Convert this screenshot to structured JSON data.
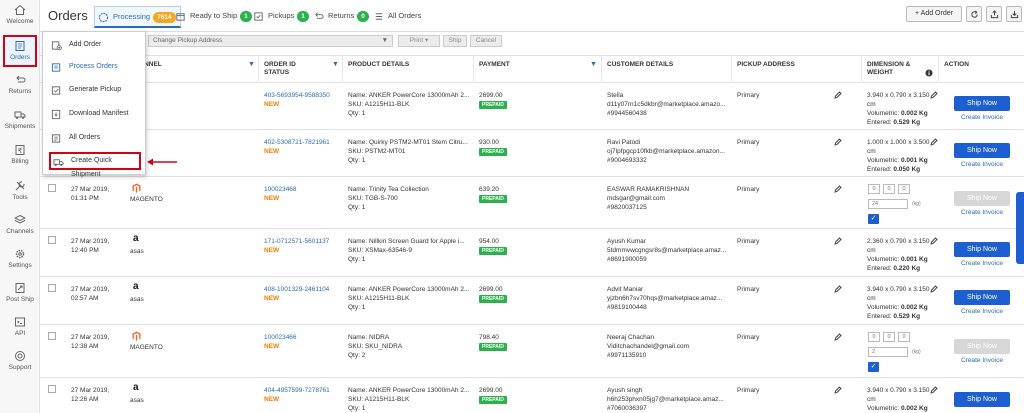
{
  "sidebar": {
    "items": [
      {
        "label": "Welcome",
        "icon": "home-icon"
      },
      {
        "label": "Orders",
        "icon": "orders-icon"
      },
      {
        "label": "Returns",
        "icon": "returns-icon"
      },
      {
        "label": "Shipments",
        "icon": "truck-icon"
      },
      {
        "label": "Billing",
        "icon": "billing-icon"
      },
      {
        "label": "Tools",
        "icon": "tools-icon"
      },
      {
        "label": "Channels",
        "icon": "channels-icon"
      },
      {
        "label": "Settings",
        "icon": "gear-icon"
      },
      {
        "label": "Post Ship",
        "icon": "post-ship-icon"
      },
      {
        "label": "API",
        "icon": "api-icon"
      },
      {
        "label": "Support",
        "icon": "support-icon"
      }
    ]
  },
  "header": {
    "title": "Orders",
    "tabs": [
      {
        "label": "Processing",
        "count": "7614",
        "badge_color": "#f5a623"
      },
      {
        "label": "Ready to Ship",
        "count": "1",
        "badge_color": "#2bb24c"
      },
      {
        "label": "Pickups",
        "count": "1",
        "badge_color": "#2bb24c"
      },
      {
        "label": "Returns",
        "count": "0",
        "badge_color": "#2bb24c"
      },
      {
        "label": "All Orders",
        "count": ""
      }
    ],
    "add_order_label": "+ Add Order"
  },
  "toolbar": {
    "pickup_placeholder": "Change Pickup Address",
    "print_label": "Print ▾",
    "ship_label": "Ship",
    "cancel_label": "Cancel"
  },
  "menu": {
    "items": [
      {
        "label": "Add Order"
      },
      {
        "label": "Process Orders"
      },
      {
        "label": "Generate Pickup"
      },
      {
        "label": "Download Manifest"
      },
      {
        "label": "All Orders"
      },
      {
        "label": "Create Quick Shipment"
      }
    ]
  },
  "table": {
    "headers": {
      "channel": "CHANNEL",
      "order_id": "ORDER ID",
      "status": "STATUS",
      "product": "PRODUCT DETAILS",
      "payment": "PAYMENT",
      "customer": "CUSTOMER DETAILS",
      "pickup": "PICKUP ADDRESS",
      "dimension": "DIMENSION &",
      "weight": "WEIGHT",
      "action": "ACTION"
    },
    "rows": [
      {
        "date": "",
        "time": "",
        "channel": "",
        "order_id": "403-5693954-9588350",
        "status": "NEW",
        "product_name": "Name: ANKER PowerCore 13000mAh 2...",
        "sku": "SKU: A1215H11-BLK",
        "qty": "Qty: 1",
        "amount": "2699.00",
        "payment_type": "PREPAID",
        "cust_name": "Stella",
        "cust_email": "d11y07rn1c5dkbr@marketplace.amazo...",
        "cust_phone": "#9944560438",
        "pickup": "Primary",
        "dims": "3.940 x 0.790 x 3.150",
        "unit": "cm",
        "volumetric_label": "Volumetric:",
        "volumetric": "0.002 Kg",
        "entered_label": "Entered:",
        "entered": "0.529 Kg",
        "ship_label": "Ship Now",
        "invoice_label": "Create Invoice",
        "ship_enabled": true
      },
      {
        "date": "",
        "time": "",
        "channel": "",
        "order_id": "402-5308721-7821961",
        "status": "NEW",
        "product_name": "Name: Quirky PSTM2-MT01 Stem Citru...",
        "sku": "SKU: PSTM2-MT01",
        "qty": "Qty: 1",
        "amount": "930.00",
        "payment_type": "PREPAID",
        "cust_name": "Ravi Patodi",
        "cust_email": "oj7lpfpgcp10fkb@marketplace.amazon...",
        "cust_phone": "#9004693332",
        "pickup": "Primary",
        "dims": "1.000 x 1.000 x 3.500",
        "unit": "cm",
        "volumetric_label": "Volumetric:",
        "volumetric": "0.001 Kg",
        "entered_label": "Entered:",
        "entered": "0.050 Kg",
        "ship_label": "Ship Now",
        "invoice_label": "Create Invoice",
        "ship_enabled": true
      },
      {
        "date": "27 Mar 2019,",
        "time": "01:31 PM",
        "channel": "MAGENTO",
        "order_id": "100023468",
        "status": "NEW",
        "product_name": "Name: Trinity Tea Collection",
        "sku": "SKU: TGB-S-700",
        "qty": "Qty: 1",
        "amount": "639.20",
        "payment_type": "PREPAID",
        "cust_name": "EASWAR RAMAKRISHNAN",
        "cust_email": "mdsgar@gmail.com",
        "cust_phone": "#9820037125",
        "pickup": "Primary",
        "dim_l": "0",
        "dim_b": "0",
        "dim_h": "0",
        "weight_input": "24",
        "weight_unit": "(kg)",
        "ship_label": "Ship Now",
        "invoice_label": "Create Invoice",
        "ship_enabled": false
      },
      {
        "date": "27 Mar 2019,",
        "time": "12:40 PM",
        "channel": "asas",
        "order_id": "171-0712571-5601137",
        "status": "NEW",
        "product_name": "Name: Nillkin Screen Guard for Apple i...",
        "sku": "SKU: XSMax-63546-9",
        "qty": "Qty: 1",
        "amount": "954.00",
        "payment_type": "PREPAID",
        "cust_name": "Ayush Kumar",
        "cust_email": "5tdmmvwcgngsr8s@marketplace.amaz...",
        "cust_phone": "#8691900059",
        "pickup": "Primary",
        "dims": "2.360 x 0.790 x 3.150",
        "unit": "cm",
        "volumetric_label": "Volumetric:",
        "volumetric": "0.001 Kg",
        "entered_label": "Entered:",
        "entered": "0.220 Kg",
        "ship_label": "Ship Now",
        "invoice_label": "Create Invoice",
        "ship_enabled": true
      },
      {
        "date": "27 Mar 2019,",
        "time": "02:57 AM",
        "channel": "asas",
        "order_id": "408-1001329-2461104",
        "status": "NEW",
        "product_name": "Name: ANKER PowerCore 13000mAh 2...",
        "sku": "SKU: A1215H11-BLK",
        "qty": "Qty: 1",
        "amount": "2699.00",
        "payment_type": "PREPAID",
        "cust_name": "Advit Maniar",
        "cust_email": "yjzbn6h7sv70hqs@marketplace.amaz...",
        "cust_phone": "#9819100448",
        "pickup": "Primary",
        "dims": "3.940 x 0.790 x 3.150",
        "unit": "cm",
        "volumetric_label": "Volumetric:",
        "volumetric": "0.002 Kg",
        "entered_label": "Entered:",
        "entered": "0.529 Kg",
        "ship_label": "Ship Now",
        "invoice_label": "Create Invoice",
        "ship_enabled": true
      },
      {
        "date": "27 Mar 2019,",
        "time": "12:38 AM",
        "channel": "MAGENTO",
        "order_id": "100023466",
        "status": "NEW",
        "product_name": "Name: NIDRA",
        "sku": "SKU: SKU_NIDRA",
        "qty": "Qty: 2",
        "amount": "798.40",
        "payment_type": "PREPAID",
        "cust_name": "Neeraj Chachan",
        "cust_email": "Viditchachandel@gmail.com",
        "cust_phone": "#9971135910",
        "pickup": "Primary",
        "dim_l": "0",
        "dim_b": "0",
        "dim_h": "0",
        "weight_input": "2",
        "weight_unit": "(kg)",
        "ship_label": "Ship Now",
        "invoice_label": "Create Invoice",
        "ship_enabled": false
      },
      {
        "date": "27 Mar 2019,",
        "time": "12:26 AM",
        "channel": "asas",
        "order_id": "404-4957599-7278761",
        "status": "NEW",
        "product_name": "Name: ANKER PowerCore 13000mAh 2...",
        "sku": "SKU: A1215H11-BLK",
        "qty": "Qty: 1",
        "amount": "2699.00",
        "payment_type": "PREPAID",
        "cust_name": "Ayush singh",
        "cust_email": "h6h253phxn05jg7@marketplace.amaz...",
        "cust_phone": "#7060036397",
        "pickup": "Primary",
        "dims": "3.940 x 0.790 x 3.150",
        "unit": "cm",
        "volumetric_label": "Volumetric:",
        "volumetric": "0.002 Kg",
        "entered_label": "Entered:",
        "entered": "",
        "ship_label": "Ship Now",
        "invoice_label": "",
        "ship_enabled": true
      }
    ]
  }
}
